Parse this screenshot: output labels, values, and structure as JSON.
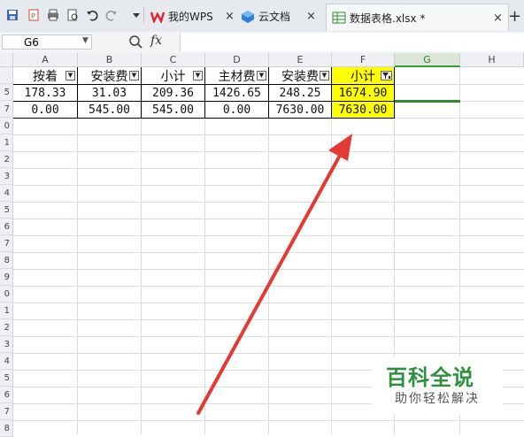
{
  "titlebar": {
    "tabs": [
      {
        "label": "我的WPS",
        "close": "×"
      },
      {
        "label": "云文档",
        "close": "×"
      },
      {
        "label": "数据表格.xlsx *",
        "close": "×"
      }
    ],
    "new_tab": "+"
  },
  "formula_bar": {
    "cell_ref": "G6",
    "fx": "fx",
    "formula": ""
  },
  "columns": [
    "A",
    "B",
    "C",
    "D",
    "E",
    "F",
    "G",
    "H"
  ],
  "rows": [
    "",
    "5",
    "7",
    "0",
    "1",
    "2",
    "3",
    "4",
    "5",
    "6",
    "7",
    "8",
    "9",
    "0",
    "1",
    "2",
    "3",
    "4",
    "5",
    "6",
    "7",
    "8"
  ],
  "table": {
    "headers": [
      "按着",
      "安装费",
      "小计",
      "主材费",
      "安装费",
      "小计"
    ],
    "data_rows": [
      [
        "178.33",
        "31.03",
        "209.36",
        "1426.65",
        "248.25",
        "1674.90"
      ],
      [
        "0.00",
        "545.00",
        "545.00",
        "0.00",
        "7630.00",
        "7630.00"
      ]
    ]
  },
  "watermark": {
    "title": "百科全说",
    "subtitle": "助你轻松解决"
  },
  "colors": {
    "highlight": "#ffff00",
    "arrow": "#e53935",
    "selection": "#2e8b2e"
  }
}
